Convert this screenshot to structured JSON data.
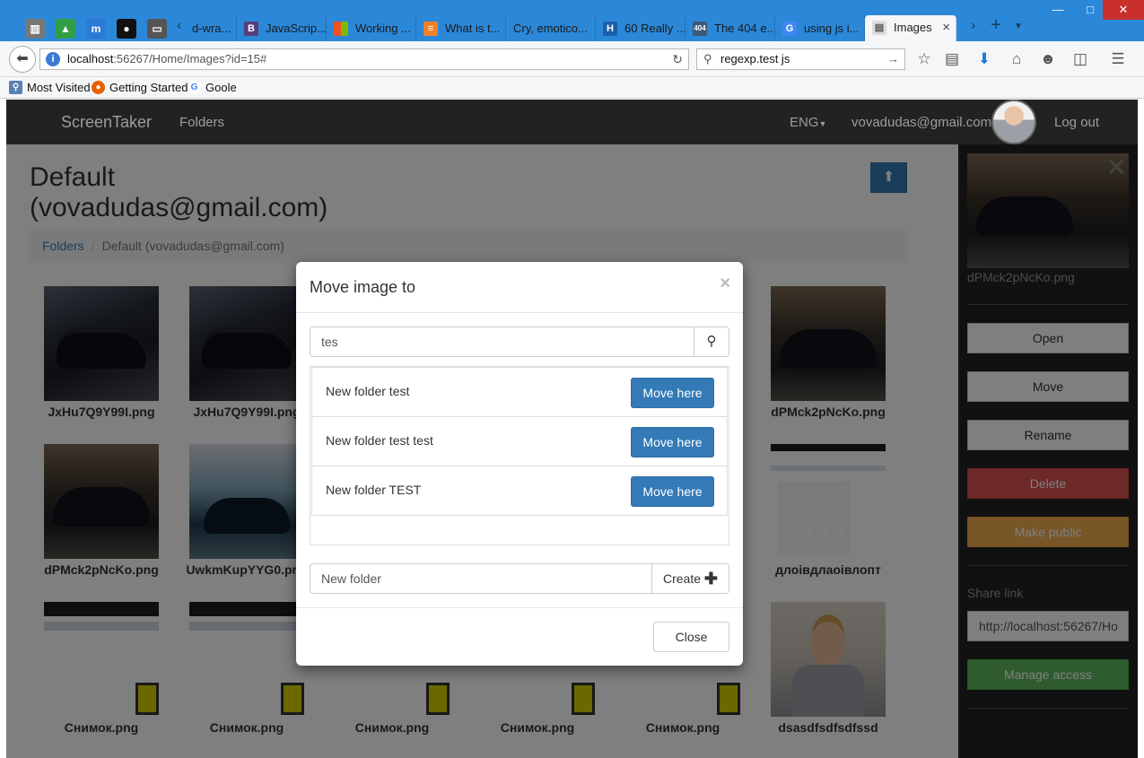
{
  "browser": {
    "tabs": [
      {
        "title": "d-wra...",
        "icon": "d"
      },
      {
        "title": "JavaScrip...",
        "icon": "B"
      },
      {
        "title": "Working ...",
        "icon": "ms"
      },
      {
        "title": "What is t...",
        "icon": "so"
      },
      {
        "title": "Cry, emotico...",
        "icon": "c"
      },
      {
        "title": "60 Really ...",
        "icon": "H"
      },
      {
        "title": "The 404 e...",
        "icon": "404"
      },
      {
        "title": "using js i...",
        "icon": "G"
      },
      {
        "title": "Images",
        "icon": "page"
      }
    ],
    "url_host": "localhost",
    "url_rest": ":56267/Home/Images?id=15#",
    "search_value": "regexp.test js",
    "bookmarks": [
      "Most Visited",
      "Getting Started",
      "Goole"
    ]
  },
  "site": {
    "brand": "ScreenTaker",
    "nav_folders": "Folders",
    "lang": "ENG",
    "email": "vovadudas@gmail.com",
    "logout": "Log out"
  },
  "main": {
    "title": "Default (vovadudas@gmail.com)",
    "breadcrumb_root": "Folders",
    "breadcrumb_sep": "/",
    "breadcrumb_current": "Default (vovadudas@gmail.com)",
    "images": [
      {
        "name": "JxHu7Q9Y99I.png",
        "kind": "car"
      },
      {
        "name": "JxHu7Q9Y99I.png",
        "kind": "car"
      },
      {
        "name": "dPMck2pNcKo.png",
        "kind": "car2"
      },
      {
        "name": "dPMck2pNcKo.png",
        "kind": "car2"
      },
      {
        "name": "UwkmKupYYG0.png",
        "kind": "car3"
      },
      {
        "name": "длоівдлаоівлопт",
        "kind": "shot"
      },
      {
        "name": "Снимок.png",
        "kind": "shot2"
      },
      {
        "name": "Снимок.png",
        "kind": "shot2"
      },
      {
        "name": "Снимок.png",
        "kind": "shot2"
      },
      {
        "name": "Снимок.png",
        "kind": "shot2"
      },
      {
        "name": "Снимок.png",
        "kind": "shot2"
      },
      {
        "name": "dsasdfsdfsdfssd",
        "kind": "person"
      }
    ]
  },
  "sidebar": {
    "file_name": "dPMck2pNcKo.png",
    "open": "Open",
    "move": "Move",
    "rename": "Rename",
    "delete": "Delete",
    "make_public": "Make public",
    "share_label": "Share link",
    "share_value": "http://localhost:56267/Ho",
    "manage_access": "Manage access"
  },
  "modal": {
    "title": "Move image to",
    "close_x": "×",
    "search_value": "tes",
    "folders": [
      {
        "name": "New folder test",
        "action": "Move here"
      },
      {
        "name": "New folder test test",
        "action": "Move here"
      },
      {
        "name": "New folder TEST",
        "action": "Move here"
      }
    ],
    "new_folder_placeholder": "New folder",
    "create_label": "Create",
    "close_label": "Close"
  },
  "colors": {
    "primary": "#337ab7",
    "danger": "#d9534f",
    "warning": "#f0ad4e",
    "success": "#5cb85c",
    "navbar": "#222222",
    "titlebar": "#2b88d9"
  }
}
